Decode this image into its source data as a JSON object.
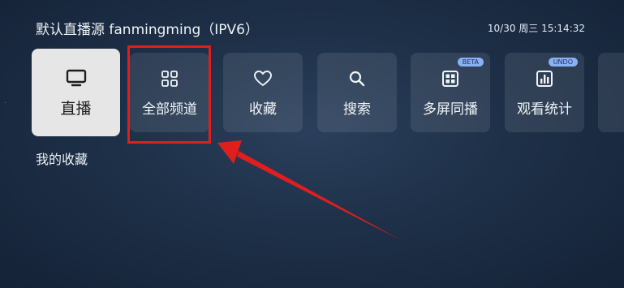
{
  "header": {
    "title": "默认直播源 fanmingming（IPV6）",
    "clock": "10/30 周三 15:14:32"
  },
  "nav": {
    "items": [
      {
        "label": "直播",
        "icon": "tv-icon",
        "active": true
      },
      {
        "label": "全部频道",
        "icon": "grid-icon",
        "active": false
      },
      {
        "label": "收藏",
        "icon": "heart-icon",
        "active": false
      },
      {
        "label": "搜索",
        "icon": "search-icon",
        "active": false
      },
      {
        "label": "多屏同播",
        "icon": "multi-screen-icon",
        "badge": "BETA",
        "active": false
      },
      {
        "label": "观看统计",
        "icon": "bar-chart-icon",
        "badge": "UNDO",
        "active": false
      }
    ]
  },
  "section": {
    "title": "我的收藏"
  },
  "colors": {
    "background": "#1e3048",
    "active_card": "#e6e6e6",
    "annotation_red": "#e01e1e",
    "badge": "#8ab0f5"
  }
}
